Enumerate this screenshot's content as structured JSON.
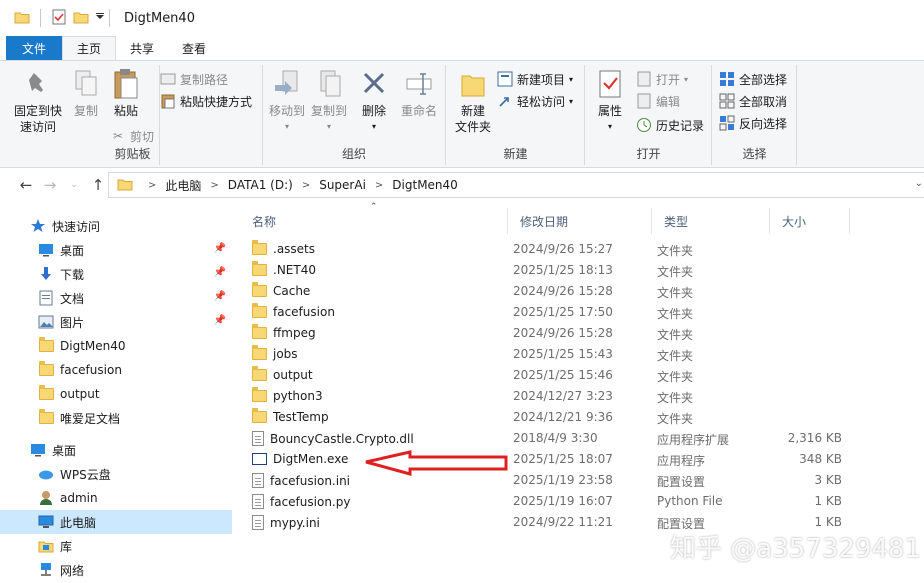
{
  "window": {
    "title": "DigtMen40"
  },
  "tabs": [
    "文件",
    "主页",
    "共享",
    "查看"
  ],
  "ribbon": {
    "clipboard": {
      "pin": "固定到快\n速访问",
      "pin_l1": "固定到快",
      "pin_l2": "速访问",
      "copy": "复制",
      "paste": "粘贴",
      "copy_path": "复制路径",
      "paste_shortcut": "粘贴快捷方式",
      "cut": "剪切",
      "label": "剪贴板"
    },
    "organize": {
      "move_to": "移动到",
      "copy_to": "复制到",
      "delete": "删除",
      "rename": "重命名",
      "label": "组织"
    },
    "new": {
      "new_folder_l1": "新建",
      "new_folder_l2": "文件夹",
      "new_item": "新建项目",
      "easy_access": "轻松访问",
      "label": "新建"
    },
    "open": {
      "properties": "属性",
      "open": "打开",
      "edit": "编辑",
      "history": "历史记录",
      "label": "打开"
    },
    "select": {
      "select_all": "全部选择",
      "select_none": "全部取消",
      "invert": "反向选择",
      "label": "选择"
    }
  },
  "address": {
    "crumbs": [
      "此电脑",
      "DATA1 (D:)",
      "SuperAi",
      "DigtMen40"
    ]
  },
  "nav": {
    "quick_access": "快速访问",
    "items": [
      {
        "label": "桌面",
        "icon": "desktop-icon",
        "pinned": true
      },
      {
        "label": "下载",
        "icon": "download-icon",
        "pinned": true
      },
      {
        "label": "文档",
        "icon": "document-icon",
        "pinned": true
      },
      {
        "label": "图片",
        "icon": "picture-icon",
        "pinned": true
      },
      {
        "label": "DigtMen40",
        "icon": "folder-icon"
      },
      {
        "label": "facefusion",
        "icon": "folder-icon"
      },
      {
        "label": "output",
        "icon": "folder-icon"
      },
      {
        "label": "唯爱足文档",
        "icon": "folder-icon"
      }
    ],
    "desktop": "桌面",
    "wps": "WPS云盘",
    "admin": "admin",
    "this_pc": "此电脑",
    "library": "库",
    "network": "网络"
  },
  "columns": {
    "name": "名称",
    "date": "修改日期",
    "type": "类型",
    "size": "大小"
  },
  "files": [
    {
      "name": ".assets",
      "date": "2024/9/26 15:27",
      "type": "文件夹",
      "size": "",
      "kind": "folder"
    },
    {
      "name": ".NET40",
      "date": "2025/1/25 18:13",
      "type": "文件夹",
      "size": "",
      "kind": "folder"
    },
    {
      "name": "Cache",
      "date": "2024/9/26 15:28",
      "type": "文件夹",
      "size": "",
      "kind": "folder"
    },
    {
      "name": "facefusion",
      "date": "2025/1/25 17:50",
      "type": "文件夹",
      "size": "",
      "kind": "folder"
    },
    {
      "name": "ffmpeg",
      "date": "2024/9/26 15:28",
      "type": "文件夹",
      "size": "",
      "kind": "folder"
    },
    {
      "name": "jobs",
      "date": "2025/1/25 15:43",
      "type": "文件夹",
      "size": "",
      "kind": "folder"
    },
    {
      "name": "output",
      "date": "2025/1/25 15:46",
      "type": "文件夹",
      "size": "",
      "kind": "folder"
    },
    {
      "name": "python3",
      "date": "2024/12/27 3:23",
      "type": "文件夹",
      "size": "",
      "kind": "folder"
    },
    {
      "name": "TestTemp",
      "date": "2024/12/21 9:36",
      "type": "文件夹",
      "size": "",
      "kind": "folder"
    },
    {
      "name": "BouncyCastle.Crypto.dll",
      "date": "2018/4/9 3:30",
      "type": "应用程序扩展",
      "size": "2,316 KB",
      "kind": "file"
    },
    {
      "name": "DigtMen.exe",
      "date": "2025/1/25 18:07",
      "type": "应用程序",
      "size": "348 KB",
      "kind": "exe"
    },
    {
      "name": "facefusion.ini",
      "date": "2025/1/19 23:58",
      "type": "配置设置",
      "size": "3 KB",
      "kind": "file"
    },
    {
      "name": "facefusion.py",
      "date": "2025/1/19 16:07",
      "type": "Python File",
      "size": "1 KB",
      "kind": "file"
    },
    {
      "name": "mypy.ini",
      "date": "2024/9/22 11:21",
      "type": "配置设置",
      "size": "1 KB",
      "kind": "file"
    }
  ],
  "watermark": "知乎 @a357329481",
  "colors": {
    "file_tab": "#1979ca",
    "selection": "#cce8ff",
    "arrow": "#e02020",
    "folder": "#f8d775"
  }
}
